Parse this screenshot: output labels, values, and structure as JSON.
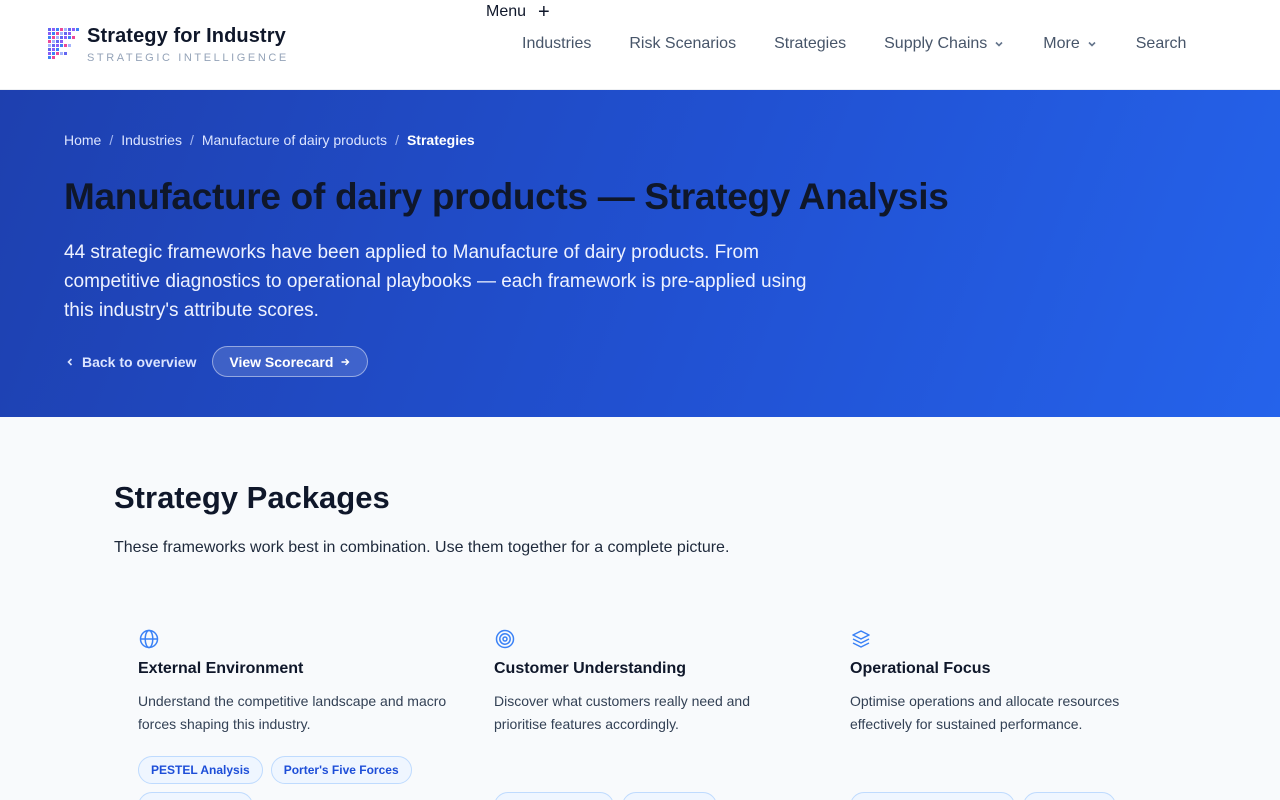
{
  "brand": {
    "title": "Strategy for Industry",
    "subtitle": "STRATEGIC INTELLIGENCE"
  },
  "menu": {
    "label": "Menu",
    "icon": "plus-icon"
  },
  "nav": [
    {
      "label": "Industries",
      "has_dropdown": false
    },
    {
      "label": "Risk Scenarios",
      "has_dropdown": false
    },
    {
      "label": "Strategies",
      "has_dropdown": false
    },
    {
      "label": "Supply Chains",
      "has_dropdown": true
    },
    {
      "label": "More",
      "has_dropdown": true
    },
    {
      "label": "Search",
      "has_dropdown": false
    }
  ],
  "breadcrumb": [
    {
      "label": "Home"
    },
    {
      "label": "Industries"
    },
    {
      "label": "Manufacture of dairy products"
    },
    {
      "label": "Strategies",
      "current": true
    }
  ],
  "hero": {
    "title": "Manufacture of dairy products — Strategy Analysis",
    "description": "44 strategic frameworks have been applied to Manufacture of dairy products. From competitive diagnostics to operational playbooks — each framework is pre-applied using this industry's attribute scores.",
    "back_label": "Back to overview",
    "scorecard_label": "View Scorecard"
  },
  "packages": {
    "title": "Strategy Packages",
    "description": "These frameworks work best in combination. Use them together for a complete picture.",
    "cards": [
      {
        "icon": "globe-icon",
        "title": "External Environment",
        "description": "Understand the competitive landscape and macro forces shaping this industry.",
        "chips": [
          "PESTEL Analysis",
          "Porter's Five Forces"
        ]
      },
      {
        "icon": "target-icon",
        "title": "Customer Understanding",
        "description": "Discover what customers really need and prioritise features accordingly.",
        "chips": []
      },
      {
        "icon": "layers-icon",
        "title": "Operational Focus",
        "description": "Optimise operations and allocate resources effectively for sustained performance.",
        "chips": []
      }
    ]
  },
  "colors": {
    "hero_start": "#1e40af",
    "hero_end": "#2563eb",
    "accent": "#3b82f6",
    "chip_bg": "#eff6ff"
  }
}
